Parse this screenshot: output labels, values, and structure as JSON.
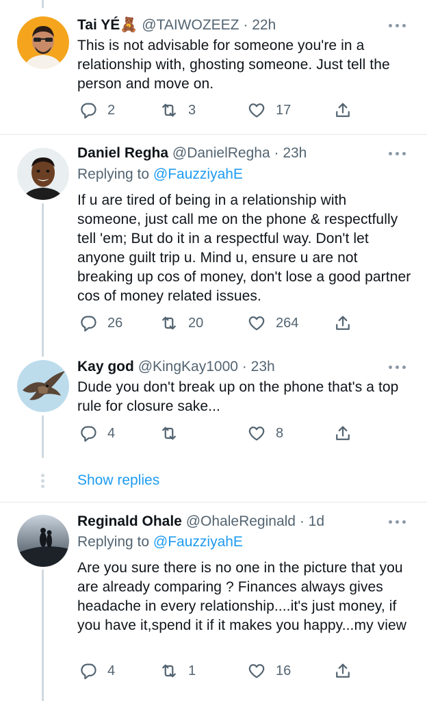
{
  "tweets": [
    {
      "name": "Tai YÉ🧸",
      "handle": "@TAIWOZEEZ",
      "sep": "·",
      "time": "22h",
      "reply_label": "",
      "reply_mention": "",
      "body": "This is not advisable for someone you're in a relationship with, ghosting someone. Just tell the person and move on.",
      "replies": "2",
      "retweets": "3",
      "likes": "17"
    },
    {
      "name": "Daniel Regha",
      "handle": "@DanielRegha",
      "sep": "·",
      "time": "23h",
      "reply_label": "Replying to ",
      "reply_mention": "@FauzziyahE",
      "body": "If u are tired of being in a relationship with someone, just  call me on the phone & respectfully tell 'em; But do it in a respectful way. Don't let anyone guilt trip u. Mind u, ensure u are not breaking up cos of money, don't lose a good partner cos of money related issues.",
      "replies": "26",
      "retweets": "20",
      "likes": "264"
    },
    {
      "name": "Kay god",
      "handle": "@KingKay1000",
      "sep": "·",
      "time": "23h",
      "reply_label": "",
      "reply_mention": "",
      "body": "Dude you don't break up on the phone that's a top rule for closure sake...",
      "replies": "4",
      "retweets": "",
      "likes": "8"
    },
    {
      "name": "Reginald Ohale",
      "handle": "@OhaleReginald",
      "sep": "·",
      "time": "1d",
      "reply_label": "Replying to ",
      "reply_mention": "@FauzziyahE",
      "body": "Are you sure there is no one in the picture that you are already comparing ? Finances always gives headache in every relationship....it's just money, if you have it,spend it if it makes you happy...my view",
      "replies": "4",
      "retweets": "1",
      "likes": "16"
    }
  ],
  "show_replies": "Show replies",
  "icons": {
    "reply": "reply-icon",
    "retweet": "retweet-icon",
    "like": "like-icon",
    "share": "share-icon",
    "more": "more-icon"
  },
  "colors": {
    "link": "#1d9bf0",
    "secondary_text": "#536471",
    "icon": "#536471",
    "thread_line": "#cfd9de"
  }
}
